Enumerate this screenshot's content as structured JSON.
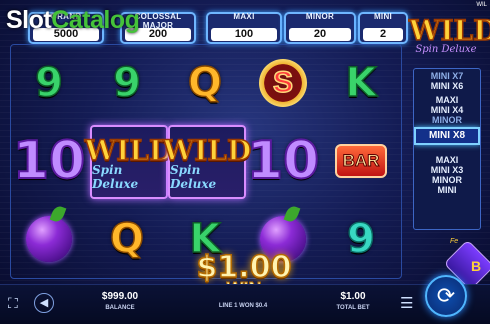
{
  "watermark": {
    "brand_a": "Slot",
    "brand_b": "Catalog"
  },
  "corner_text": "WIL",
  "jackpots": [
    {
      "name": "GRAND",
      "value": "5000"
    },
    {
      "name": "COLOSSAL MAJOR",
      "value": "200"
    },
    {
      "name": "MAXI",
      "value": "100"
    },
    {
      "name": "MINOR",
      "value": "20"
    },
    {
      "name": "MINI",
      "value": "2"
    }
  ],
  "reels": [
    [
      "9",
      "10",
      "plum"
    ],
    [
      "9",
      "WILD",
      "Q"
    ],
    [
      "Q",
      "WILD",
      "K"
    ],
    [
      "S",
      "10",
      "plum"
    ],
    [
      "K",
      "BAR",
      "9"
    ]
  ],
  "wild_text": {
    "word": "WILD",
    "sub": "Spin Deluxe"
  },
  "win": {
    "amount": "$1.00",
    "label": "WIN"
  },
  "side_panel": {
    "title": "WILD",
    "subtitle": "Spin Deluxe",
    "ladder": [
      "MINI X7",
      "MINI X6",
      "MAXI",
      "MINI X4",
      "MINOR",
      "MINI X8",
      "MAXI",
      "MINI X3",
      "MINOR",
      "MINI"
    ],
    "selected": "MINI X8",
    "feature_tag": "Fe",
    "feature_letter": "B"
  },
  "bottom": {
    "balance_value": "$999.00",
    "balance_label": "BALANCE",
    "line_info": "LINE 1 WON $0.4",
    "bet_value": "$1.00",
    "bet_label": "TOTAL BET"
  },
  "icons": {
    "fullscreen": "fullscreen-icon",
    "sound": "speaker-icon",
    "stack": "coins-icon",
    "spin": "refresh-icon"
  },
  "colors": {
    "accent": "#4fb6ff",
    "gold": "#ffd23a",
    "purple": "#c08bff"
  }
}
